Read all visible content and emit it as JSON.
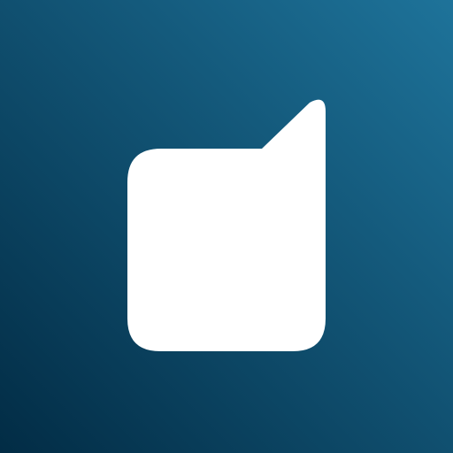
{
  "app_icon": {
    "icon_name": "speech-bubble-icon",
    "colors": {
      "background_gradient_dark": "#022c45",
      "background_gradient_light": "#1e739a",
      "glyph": "#ffffff"
    }
  }
}
